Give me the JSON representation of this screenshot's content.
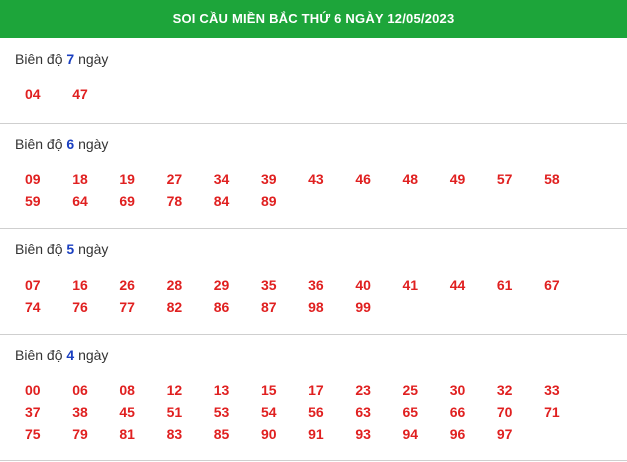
{
  "header": {
    "title": "SOI CẦU MIỀN BẮC THỨ 6 NGÀY 12/05/2023"
  },
  "sections": [
    {
      "prefix": "Biên độ",
      "amplitude": "7",
      "suffix": "ngày",
      "numbers": [
        "04",
        "47"
      ]
    },
    {
      "prefix": "Biên độ",
      "amplitude": "6",
      "suffix": "ngày",
      "numbers": [
        "09",
        "18",
        "19",
        "27",
        "34",
        "39",
        "43",
        "46",
        "48",
        "49",
        "57",
        "58",
        "59",
        "64",
        "69",
        "78",
        "84",
        "89"
      ]
    },
    {
      "prefix": "Biên độ",
      "amplitude": "5",
      "suffix": "ngày",
      "numbers": [
        "07",
        "16",
        "26",
        "28",
        "29",
        "35",
        "36",
        "40",
        "41",
        "44",
        "61",
        "67",
        "74",
        "76",
        "77",
        "82",
        "86",
        "87",
        "98",
        "99"
      ]
    },
    {
      "prefix": "Biên độ",
      "amplitude": "4",
      "suffix": "ngày",
      "numbers": [
        "00",
        "06",
        "08",
        "12",
        "13",
        "15",
        "17",
        "23",
        "25",
        "30",
        "32",
        "33",
        "37",
        "38",
        "45",
        "51",
        "53",
        "54",
        "56",
        "63",
        "65",
        "66",
        "70",
        "71",
        "75",
        "79",
        "81",
        "83",
        "85",
        "90",
        "91",
        "93",
        "94",
        "96",
        "97"
      ]
    }
  ]
}
